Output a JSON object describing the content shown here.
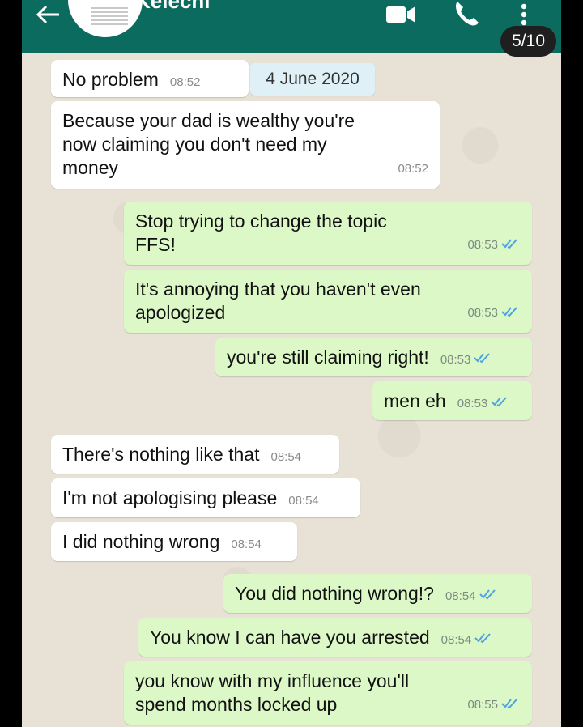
{
  "header": {
    "contact_name": "Kelechi",
    "counter": "5/10",
    "icons": [
      "back-arrow-icon",
      "video-call-icon",
      "phone-icon",
      "more-vert-icon"
    ],
    "color": "#0b6b5e"
  },
  "date_chip": "4 June 2020",
  "colors": {
    "incoming": "#ffffff",
    "outgoing": "#dcf8c6",
    "read_ticks": "#4fa3e0"
  },
  "messages": [
    {
      "dir": "in",
      "text": "No problem",
      "time": "08:52"
    },
    {
      "dir": "in",
      "text": "Because your dad is wealthy you're now claiming you don't need my money",
      "time": "08:52"
    },
    {
      "dir": "out",
      "text": "Stop trying to change the topic FFS!",
      "time": "08:53",
      "status": "read"
    },
    {
      "dir": "out",
      "text": "It's annoying that you haven't even apologized",
      "time": "08:53",
      "status": "read"
    },
    {
      "dir": "out",
      "text": "you're still claiming right!",
      "time": "08:53",
      "status": "read"
    },
    {
      "dir": "out",
      "text": "men eh",
      "time": "08:53",
      "status": "read"
    },
    {
      "dir": "in",
      "text": "There's nothing like that",
      "time": "08:54"
    },
    {
      "dir": "in",
      "text": "I'm not apologising please",
      "time": "08:54"
    },
    {
      "dir": "in",
      "text": "I did nothing wrong",
      "time": "08:54"
    },
    {
      "dir": "out",
      "text": "You did nothing wrong!?",
      "time": "08:54",
      "status": "read"
    },
    {
      "dir": "out",
      "text": "You know I can have you arrested",
      "time": "08:54",
      "status": "read"
    },
    {
      "dir": "out",
      "text": "you know with my influence you'll spend months locked up",
      "time": "08:55",
      "status": "read"
    }
  ]
}
